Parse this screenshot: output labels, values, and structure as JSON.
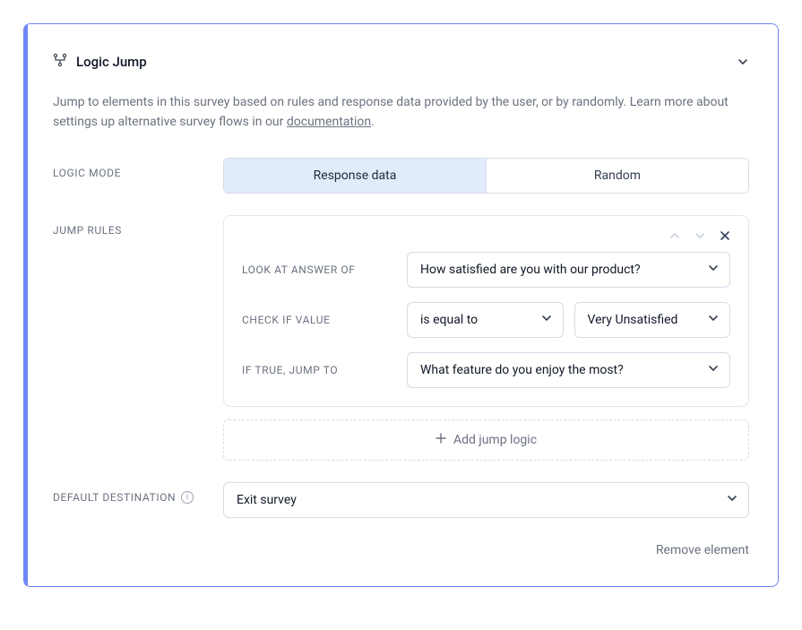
{
  "panel": {
    "title": "Logic Jump",
    "description_prefix": "Jump to elements in this survey based on rules and response data provided by the user, or by randomly. Learn more about settings up alternative survey flows in our ",
    "doc_link_label": "documentation",
    "description_suffix": "."
  },
  "labels": {
    "logic_mode": "LOGIC MODE",
    "jump_rules": "JUMP RULES",
    "default_destination": "DEFAULT DESTINATION",
    "look_at": "LOOK AT ANSWER OF",
    "check_if": "CHECK IF VALUE",
    "if_true": "IF TRUE, JUMP TO",
    "add_jump": "Add jump logic",
    "remove_element": "Remove element"
  },
  "logic_mode": {
    "options": [
      "Response data",
      "Random"
    ],
    "selected_index": 0
  },
  "rule": {
    "question_select": "How satisfied are you with our product?",
    "operator_select": "is equal to",
    "value_select": "Very Unsatisfied",
    "target_select": "What feature do you enjoy the most?"
  },
  "default_destination": {
    "value": "Exit survey"
  }
}
